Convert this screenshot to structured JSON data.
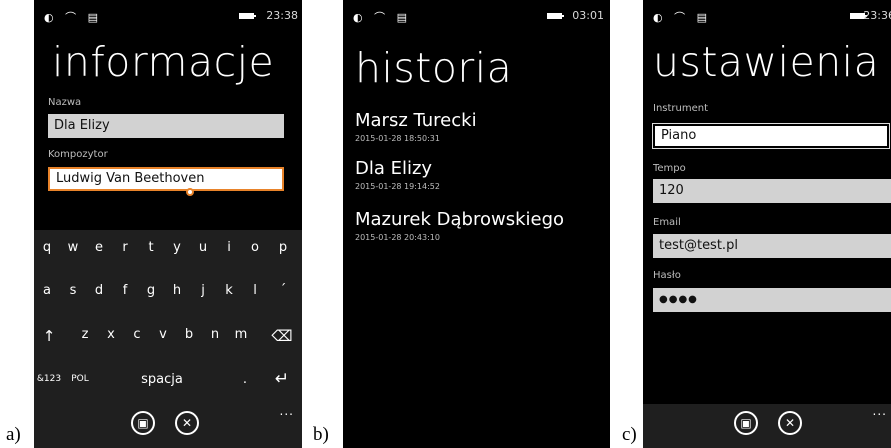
{
  "labels": {
    "a": "a)",
    "b": "b)",
    "c": "c)"
  },
  "panel_a": {
    "status_icons": "◐ ⌒ ▤",
    "time": "23:38",
    "title": "informacje",
    "fields": [
      {
        "label": "Nazwa",
        "value": "Dla Elizy"
      },
      {
        "label": "Kompozytor",
        "value": "Ludwig Van Beethoven"
      }
    ],
    "keyboard": {
      "row1": [
        "q",
        "w",
        "e",
        "r",
        "t",
        "y",
        "u",
        "i",
        "o",
        "p"
      ],
      "row2": [
        "a",
        "s",
        "d",
        "f",
        "g",
        "h",
        "j",
        "k",
        "l",
        "´"
      ],
      "row3": [
        "↑",
        "z",
        "x",
        "c",
        "v",
        "b",
        "n",
        "m",
        "⌫"
      ],
      "row4": {
        "num": "&123",
        "lang": "POL",
        "space": "spacja",
        "dot": ".",
        "enter": "↵"
      }
    },
    "appbar": {
      "save_icon": "▣",
      "cancel_icon": "✕",
      "dots": "..."
    }
  },
  "panel_b": {
    "status_icons": "◐ ⌒ ▤",
    "time": "03:01",
    "title": "historia",
    "items": [
      {
        "name": "Marsz Turecki",
        "time": "2015-01-28 18:50:31"
      },
      {
        "name": "Dla Elizy",
        "time": "2015-01-28 19:14:52"
      },
      {
        "name": "Mazurek Dąbrowskiego",
        "time": "2015-01-28 20:43:10"
      }
    ]
  },
  "panel_c": {
    "status_icons": "◐ ⌒ ▤",
    "time": "23:36",
    "title": "ustawienia",
    "fields": [
      {
        "label": "Instrument",
        "value": "Piano"
      },
      {
        "label": "Tempo",
        "value": "120"
      },
      {
        "label": "Email",
        "value": "test@test.pl"
      },
      {
        "label": "Hasło",
        "value": "●●●●"
      }
    ],
    "appbar": {
      "save_icon": "▣",
      "cancel_icon": "✕",
      "dots": "..."
    }
  },
  "colors": {
    "accent": "#e8832a",
    "field_bg": "#d2d2d2",
    "background": "#000000"
  }
}
